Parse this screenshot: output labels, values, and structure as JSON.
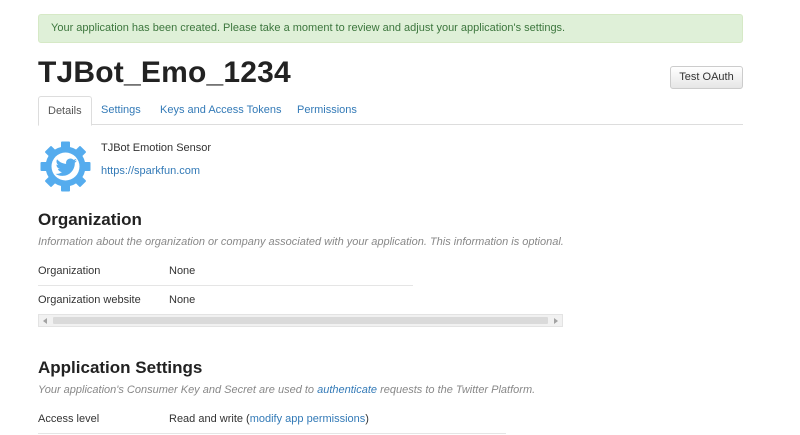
{
  "alert": {
    "text": "Your application has been created. Please take a moment to review and adjust your application's settings."
  },
  "app": {
    "title": "TJBot_Emo_1234",
    "description": "TJBot Emotion Sensor",
    "url": "https://sparkfun.com",
    "logo_icon": "twitter-gear-icon"
  },
  "buttons": {
    "test_oauth": "Test OAuth"
  },
  "tabs": [
    {
      "label": "Details",
      "active": true
    },
    {
      "label": "Settings",
      "active": false
    },
    {
      "label": "Keys and Access Tokens",
      "active": false
    },
    {
      "label": "Permissions",
      "active": false
    }
  ],
  "organization": {
    "title": "Organization",
    "help": "Information about the organization or company associated with your application. This information is optional.",
    "rows": [
      {
        "key": "Organization",
        "value": "None"
      },
      {
        "key": "Organization website",
        "value": "None"
      }
    ]
  },
  "app_settings": {
    "title": "Application Settings",
    "help_before": "Your application's Consumer Key and Secret are used to ",
    "help_link": "authenticate",
    "help_after": " requests to the Twitter Platform.",
    "rows": [
      {
        "key": "Access level",
        "value_text": "Read and write (",
        "value_link": "modify app permissions",
        "value_after": ")"
      }
    ]
  },
  "colors": {
    "alert_bg": "#dff0d8",
    "alert_text": "#3c763d",
    "link": "#337ab7",
    "logo_blue": "#55acee"
  }
}
